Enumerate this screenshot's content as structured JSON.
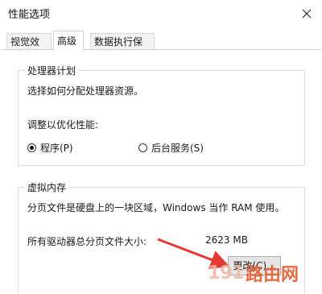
{
  "window": {
    "title": "性能选项",
    "close_icon": "close-icon"
  },
  "tabs": [
    {
      "label": "视觉效果"
    },
    {
      "label": "高级"
    },
    {
      "label": "数据执行保护"
    }
  ],
  "processor": {
    "group_label": "处理器计划",
    "description": "选择如何分配处理器资源。",
    "adjust_label": "调整以优化性能:",
    "options": [
      {
        "label": "程序(P)",
        "selected": true
      },
      {
        "label": "后台服务(S)",
        "selected": false
      }
    ]
  },
  "virtual_memory": {
    "group_label": "虚拟内存",
    "description": "分页文件是硬盘上的一块区域，Windows 当作 RAM 使用。",
    "total_label": "所有驱动器总分页文件大小:",
    "total_value": "2623 MB",
    "change_button": "更改(C)..."
  },
  "watermark": {
    "number": "191",
    "text": "路由网"
  },
  "colors": {
    "arrow": "#e53935",
    "watermark_red": "#e5562a"
  }
}
